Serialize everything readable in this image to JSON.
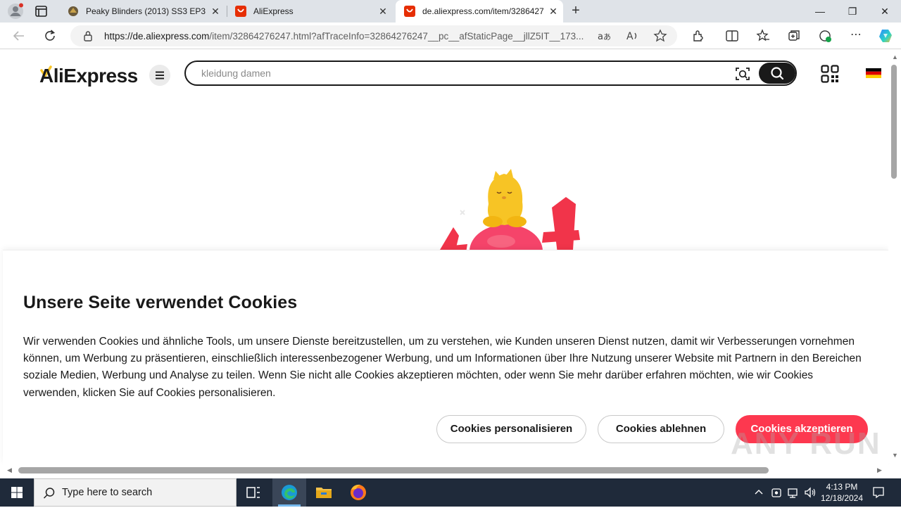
{
  "browser": {
    "tabs": [
      {
        "title": "Peaky Blinders (2013) SS3 EP3",
        "active": false
      },
      {
        "title": "AliExpress",
        "active": false
      },
      {
        "title": "de.aliexpress.com/item/3286427",
        "active": true
      }
    ],
    "close_glyph": "✕",
    "new_tab_glyph": "+",
    "window_controls": {
      "minimize": "—",
      "restore": "❐",
      "close": "✕"
    },
    "url_domain": "https://de.aliexpress.com",
    "url_path": "/item/32864276247.html?afTraceInfo=32864276247__pc__afStaticPage__jllZ5IT__173..."
  },
  "site": {
    "logo_text": "AliExpress",
    "search_placeholder": "kleidung damen"
  },
  "cookie": {
    "title": "Unsere Seite verwendet Cookies",
    "body": "Wir verwenden Cookies und ähnliche Tools, um unsere Dienste bereitzustellen, um zu verstehen, wie Kunden unseren Dienst nutzen, damit wir Verbesserungen vornehmen können, um Werbung zu präsentieren, einschließlich interessenbezogener Werbung, und um Informationen über Ihre Nutzung unserer Website mit Partnern in den Bereichen soziale Medien, Werbung und Analyse zu teilen. Wenn Sie nicht alle Cookies akzeptieren möchten, oder wenn Sie mehr darüber erfahren möchten, wie wir Cookies verwenden, klicken Sie auf Cookies personalisieren.",
    "btn_personalize": "Cookies personalisieren",
    "btn_reject": "Cookies ablehnen",
    "btn_accept": "Cookies akzeptieren"
  },
  "watermark": "ANY RUN",
  "taskbar": {
    "search_placeholder": "Type here to search",
    "time": "4:13 PM",
    "date": "12/18/2024"
  },
  "colors": {
    "accent": "#fd384f",
    "logo_dark": "#191919",
    "logo_yellow": "#f7c425"
  }
}
